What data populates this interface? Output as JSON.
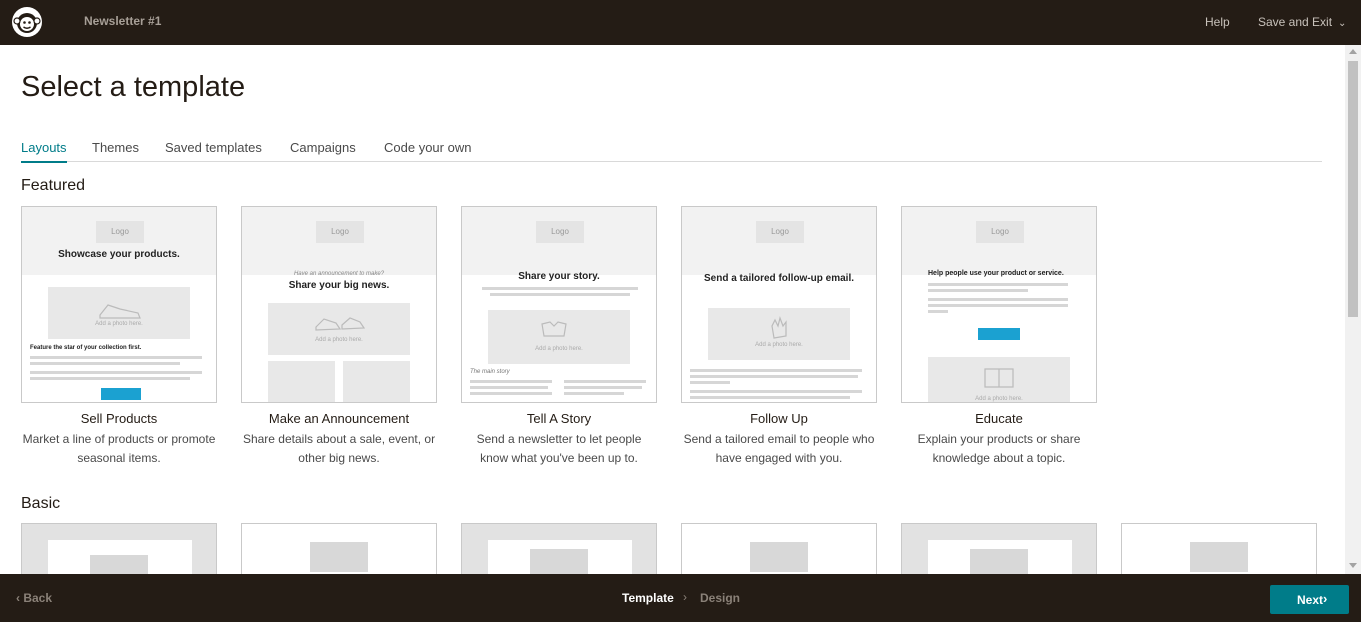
{
  "topbar": {
    "campaign_name": "Newsletter #1",
    "help_label": "Help",
    "save_exit_label": "Save and Exit"
  },
  "page": {
    "title": "Select a template"
  },
  "tabs": [
    {
      "label": "Layouts",
      "active": true
    },
    {
      "label": "Themes",
      "active": false
    },
    {
      "label": "Saved templates",
      "active": false
    },
    {
      "label": "Campaigns",
      "active": false
    },
    {
      "label": "Code your own",
      "active": false
    }
  ],
  "featured": {
    "section_title": "Featured",
    "cards": [
      {
        "title": "Sell Products",
        "desc": "Market a line of products or promote seasonal items.",
        "thumb_heading": "Showcase your products.",
        "thumb_sub": "Feature the star of your collection first.",
        "thumb_button": "Start Shopping",
        "logo": "Logo",
        "photo_caption": "Add a photo here."
      },
      {
        "title": "Make an Announcement",
        "desc": "Share details about a sale, event, or other big news.",
        "thumb_kicker": "Have an announcement to make?",
        "thumb_heading": "Share your big news.",
        "logo": "Logo",
        "photo_caption": "Add a photo here."
      },
      {
        "title": "Tell A Story",
        "desc": "Send a newsletter to let people know what you've been up to.",
        "thumb_heading": "Share your story.",
        "thumb_sub": "The main story",
        "logo": "Logo",
        "photo_caption": "Add a photo here."
      },
      {
        "title": "Follow Up",
        "desc": "Send a tailored email to people who have engaged with you.",
        "thumb_heading": "Send a tailored follow-up email.",
        "logo": "Logo",
        "photo_caption": "Add a photo here."
      },
      {
        "title": "Educate",
        "desc": "Explain your products or share knowledge about a topic.",
        "thumb_heading": "Help people use your product or service.",
        "thumb_button": "Let's Get Started",
        "logo": "Logo",
        "photo_caption": "Add a photo here."
      }
    ]
  },
  "basic": {
    "section_title": "Basic"
  },
  "bottombar": {
    "back_label": "Back",
    "step_template": "Template",
    "step_design": "Design",
    "next_label": "Next"
  },
  "colors": {
    "topbar_bg": "#241c15",
    "accent_teal": "#007c89",
    "button_blue": "#1ba1d1"
  }
}
